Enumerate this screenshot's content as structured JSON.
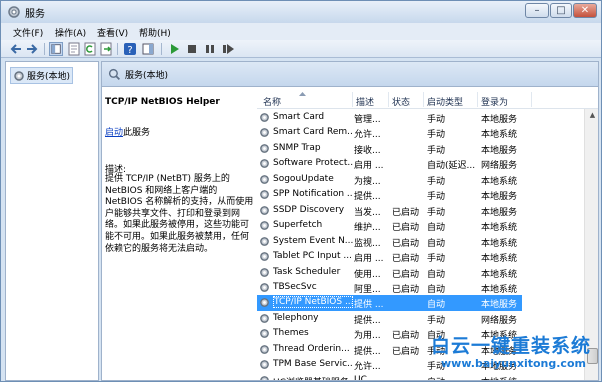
{
  "window": {
    "title": "服务",
    "minimize": "–",
    "maximize": "□",
    "close": "✕"
  },
  "menu": [
    "文件(F)",
    "操作(A)",
    "查看(V)",
    "帮助(H)"
  ],
  "toolbar": {
    "icons": [
      "back-icon",
      "forward-icon",
      "console-tree-icon",
      "properties-icon",
      "refresh-icon",
      "export-list-icon",
      "help-icon",
      "action-pane-icon",
      "start-service-icon",
      "stop-service-icon",
      "pause-service-icon",
      "restart-service-icon"
    ]
  },
  "tree": {
    "node_label": "服务(本地)"
  },
  "panel": {
    "header": "服务(本地)"
  },
  "detail": {
    "service_name": "TCP/IP NetBIOS Helper",
    "start_link": "启动",
    "start_suffix": "此服务",
    "description_label": "描述:",
    "description": "提供 TCP/IP (NetBT) 服务上的 NetBIOS 和网络上客户端的 NetBIOS 名称解析的支持，从而使用户能够共享文件、打印和登录到网络。如果此服务被停用，这些功能可能不可用。如果此服务被禁用，任何依赖它的服务将无法启动。"
  },
  "columns": {
    "name": "名称",
    "description": "描述",
    "status": "状态",
    "startup": "启动类型",
    "logon": "登录为"
  },
  "services": [
    {
      "name": "Smart Card",
      "desc": "管理...",
      "status": "",
      "startup": "手动",
      "logon": "本地服务",
      "selected": false
    },
    {
      "name": "Smart Card Rem...",
      "desc": "允许...",
      "status": "",
      "startup": "手动",
      "logon": "本地系统",
      "selected": false
    },
    {
      "name": "SNMP Trap",
      "desc": "接收...",
      "status": "",
      "startup": "手动",
      "logon": "本地服务",
      "selected": false
    },
    {
      "name": "Software Protect...",
      "desc": "启用 ...",
      "status": "",
      "startup": "自动(延迟...",
      "logon": "网络服务",
      "selected": false
    },
    {
      "name": "SogouUpdate",
      "desc": "为搜...",
      "status": "",
      "startup": "手动",
      "logon": "本地系统",
      "selected": false
    },
    {
      "name": "SPP Notification ...",
      "desc": "提供...",
      "status": "",
      "startup": "手动",
      "logon": "本地服务",
      "selected": false
    },
    {
      "name": "SSDP Discovery",
      "desc": "当发...",
      "status": "已启动",
      "startup": "手动",
      "logon": "本地服务",
      "selected": false
    },
    {
      "name": "Superfetch",
      "desc": "维护...",
      "status": "已启动",
      "startup": "自动",
      "logon": "本地系统",
      "selected": false
    },
    {
      "name": "System Event N...",
      "desc": "监视...",
      "status": "已启动",
      "startup": "自动",
      "logon": "本地系统",
      "selected": false
    },
    {
      "name": "Tablet PC Input ...",
      "desc": "启用 ...",
      "status": "已启动",
      "startup": "手动",
      "logon": "本地系统",
      "selected": false
    },
    {
      "name": "Task Scheduler",
      "desc": "使用...",
      "status": "已启动",
      "startup": "自动",
      "logon": "本地系统",
      "selected": false
    },
    {
      "name": "TBSecSvc",
      "desc": "阿里...",
      "status": "已启动",
      "startup": "自动",
      "logon": "本地系统",
      "selected": false
    },
    {
      "name": "TCP/IP NetBIOS ...",
      "desc": "提供 ...",
      "status": "",
      "startup": "自动",
      "logon": "本地服务",
      "selected": true
    },
    {
      "name": "Telephony",
      "desc": "提供...",
      "status": "",
      "startup": "手动",
      "logon": "网络服务",
      "selected": false
    },
    {
      "name": "Themes",
      "desc": "为用...",
      "status": "已启动",
      "startup": "自动",
      "logon": "本地系统",
      "selected": false
    },
    {
      "name": "Thread Orderin...",
      "desc": "提供...",
      "status": "已启动",
      "startup": "手动",
      "logon": "本地服务",
      "selected": false
    },
    {
      "name": "TPM Base Servic...",
      "desc": "允许...",
      "status": "",
      "startup": "手动",
      "logon": "本地服务",
      "selected": false
    },
    {
      "name": "UC浏览器基础服务",
      "desc": "UC...",
      "status": "",
      "startup": "自动",
      "logon": "本地系统",
      "selected": false
    }
  ],
  "watermark": {
    "text": "白云一键重装系统",
    "url": "www.baiyunxitong.com"
  },
  "colors": {
    "selection": "#3399ff",
    "link": "#0a3fc2",
    "watermark": "#1c7bd6"
  }
}
